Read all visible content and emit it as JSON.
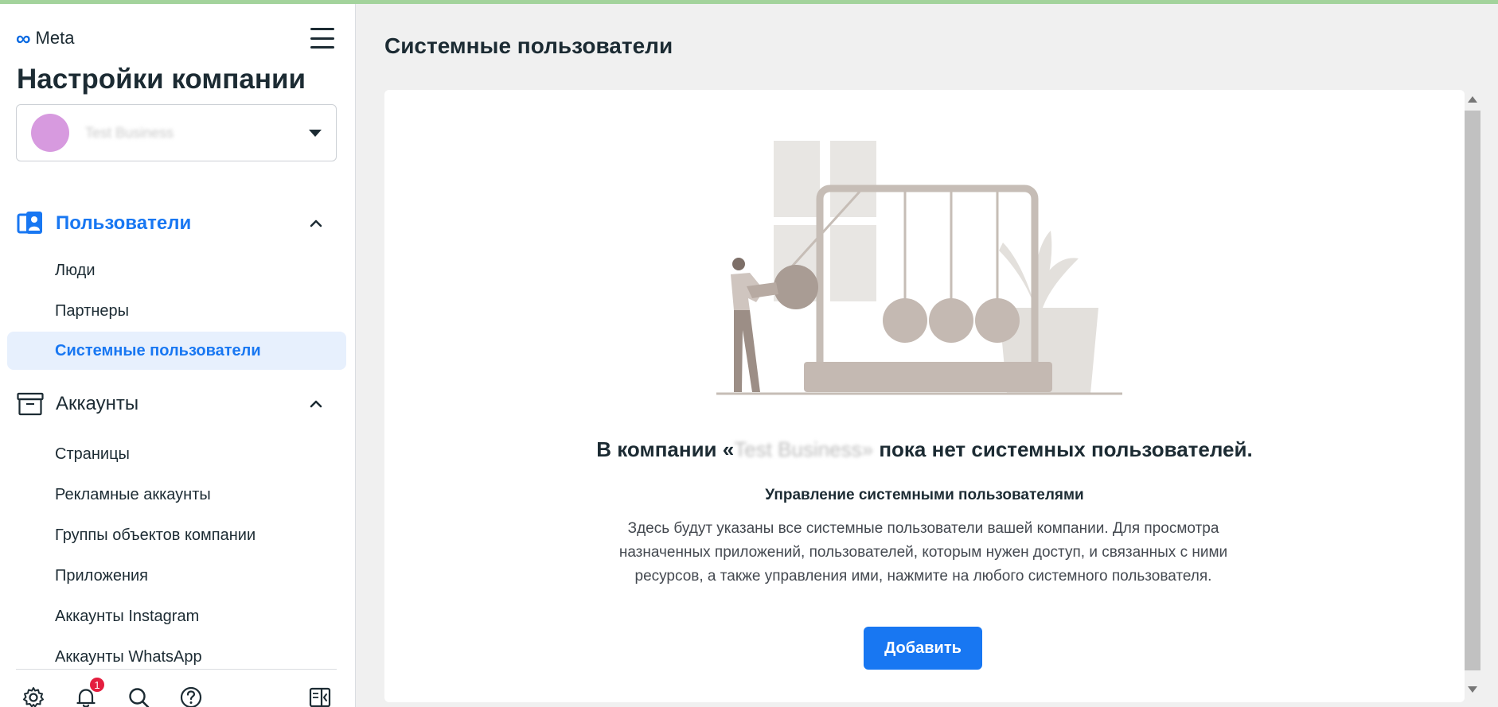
{
  "app": {
    "logo_text": "Meta",
    "page_title": "Настройки компании"
  },
  "business_selector": {
    "name": "Test Business",
    "avatar_color": "#d79adf"
  },
  "sidebar": {
    "users_section": {
      "label": "Пользователи",
      "icon": "users-icon",
      "expanded": true
    },
    "users_items": [
      {
        "label": "Люди",
        "active": false
      },
      {
        "label": "Партнеры",
        "active": false
      },
      {
        "label": "Системные пользователи",
        "active": true
      }
    ],
    "accounts_section": {
      "label": "Аккаунты",
      "icon": "archive-box-icon",
      "expanded": true
    },
    "accounts_items": [
      {
        "label": "Страницы"
      },
      {
        "label": "Рекламные аккаунты"
      },
      {
        "label": "Группы объектов компании"
      },
      {
        "label": "Приложения"
      },
      {
        "label": "Аккаунты Instagram"
      },
      {
        "label": "Аккаунты WhatsApp"
      }
    ],
    "bottom_icons": [
      "settings-icon",
      "notifications-icon",
      "search-icon",
      "help-icon",
      "collapse-panel-icon"
    ],
    "notification_count": "1"
  },
  "main": {
    "title": "Системные пользователи",
    "empty_heading_prefix": "В компании «",
    "empty_heading_company": "Test Business»",
    "empty_heading_suffix": " пока нет системных пользователей.",
    "subheading": "Управление системными пользователями",
    "description": "Здесь будут указаны все системные пользователи вашей компании. Для просмотра назначенных приложений, пользователей, которым нужен доступ, и связанных с ними ресурсов, а также управления ими, нажмите на любого системного пользователя.",
    "add_button": "Добавить"
  },
  "colors": {
    "accent": "#1877f2",
    "active_bg": "#e7f0fd",
    "badge": "#e41e3f"
  }
}
